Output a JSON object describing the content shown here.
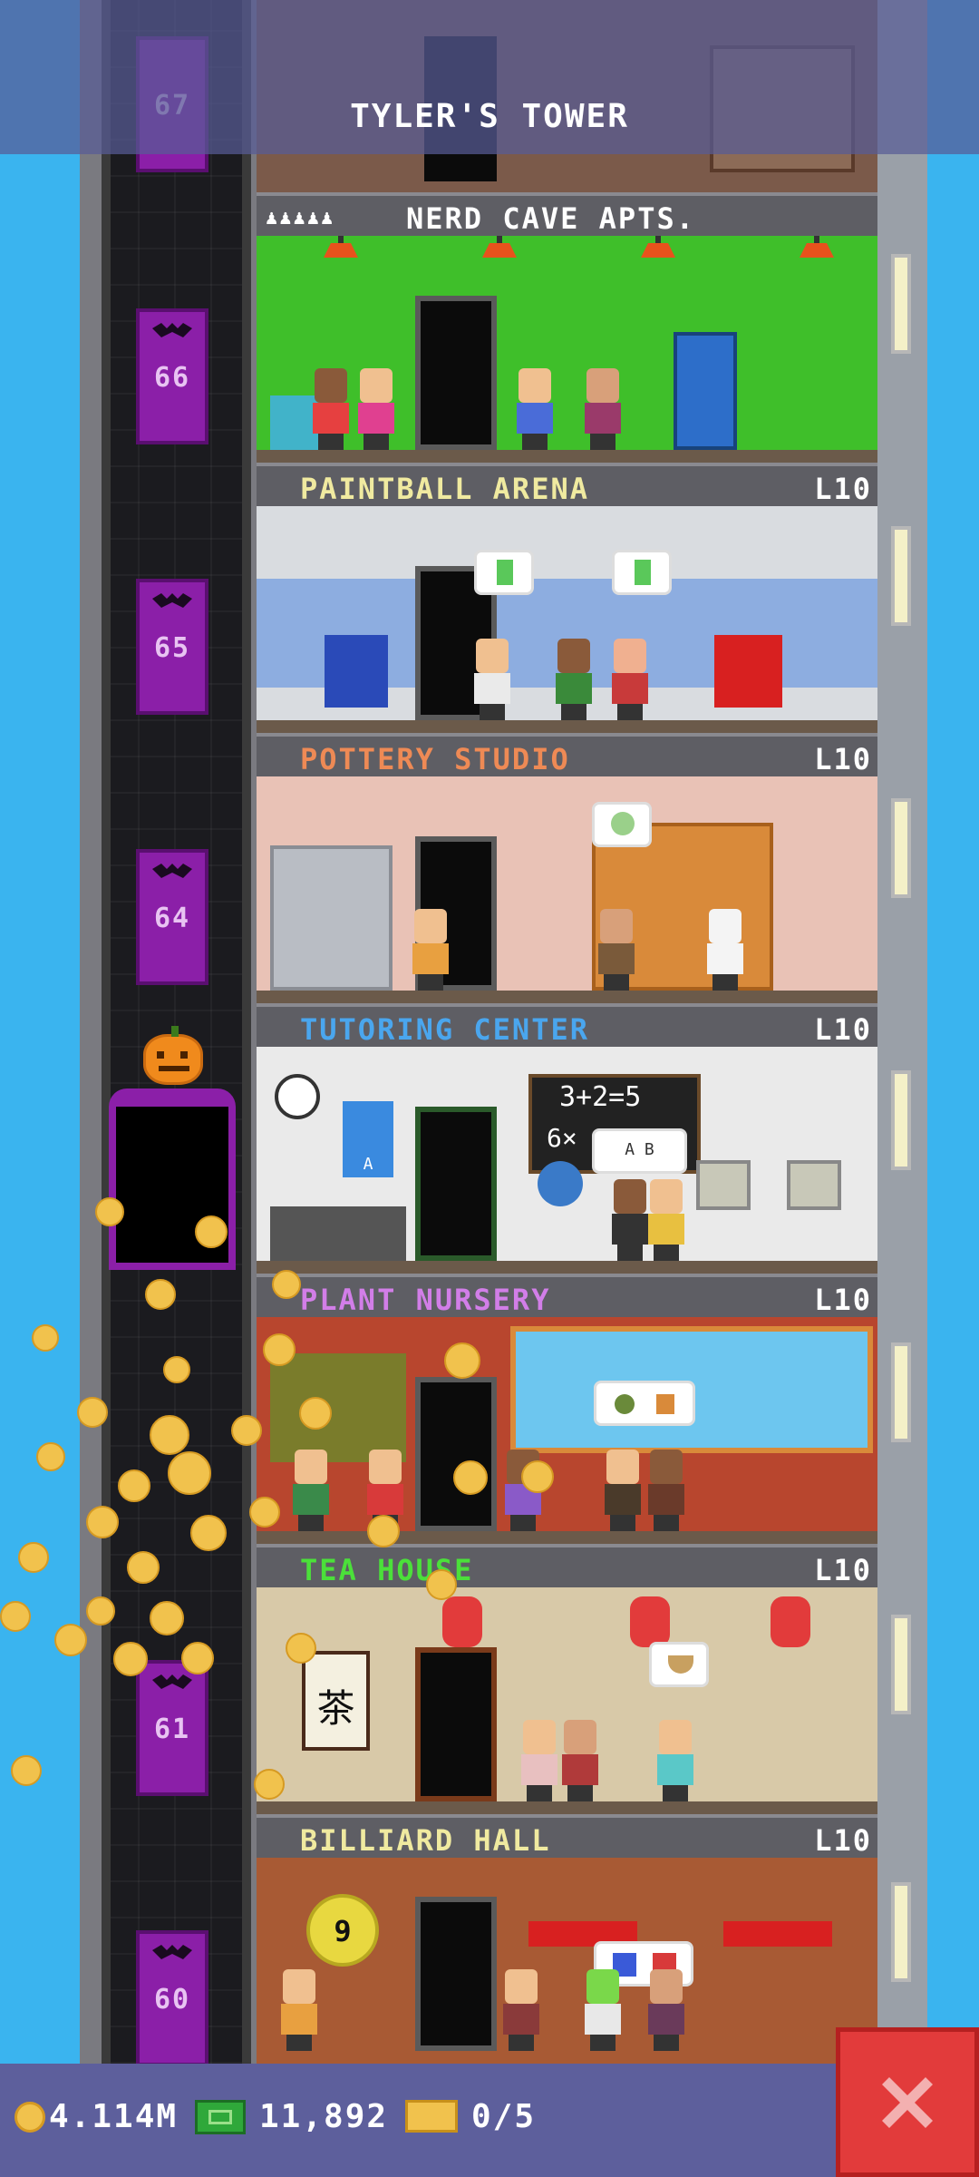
{
  "header": {
    "title": "TYLER'S TOWER"
  },
  "elevator": {
    "floor_numbers": [
      "67",
      "66",
      "65",
      "64",
      "61",
      "60"
    ]
  },
  "floors": [
    {
      "name": "NERD CAVE APTS.",
      "level": "",
      "label_color": "#ffffff",
      "residents_icon": "person-icons",
      "room_color": "#3fbf2a"
    },
    {
      "name": "PAINTBALL ARENA",
      "level": "L10",
      "label_color": "#f0eaa0",
      "room_color": "#d9dce0"
    },
    {
      "name": "POTTERY STUDIO",
      "level": "L10",
      "label_color": "#ee8a55",
      "room_color": "#e9c2b6"
    },
    {
      "name": "TUTORING CENTER",
      "level": "L10",
      "label_color": "#4aa6ee",
      "room_color": "#eaeaea"
    },
    {
      "name": "PLANT NURSERY",
      "level": "L10",
      "label_color": "#d27ee8",
      "room_color": "#b8462e"
    },
    {
      "name": "TEA HOUSE",
      "level": "L10",
      "label_color": "#4be03a",
      "room_color": "#d8c9a8"
    },
    {
      "name": "BILLIARD HALL",
      "level": "L10",
      "label_color": "#f0eaa0",
      "room_color": "#a85a34"
    }
  ],
  "room_text": {
    "chalkboard": "3+2=5",
    "chalkboard_line2": "6×",
    "bubble_ab": "A B",
    "poster_letter": "A",
    "tea_sign": "茶",
    "ball_number": "9"
  },
  "bottom_bar": {
    "coins": "4.114M",
    "bux": "11,892",
    "tickets": "0/5"
  },
  "colors": {
    "sky": "#3ab4ef",
    "header": "#585c96",
    "close": "#e23b3b",
    "elevator_pad": "#8b1fa8"
  }
}
